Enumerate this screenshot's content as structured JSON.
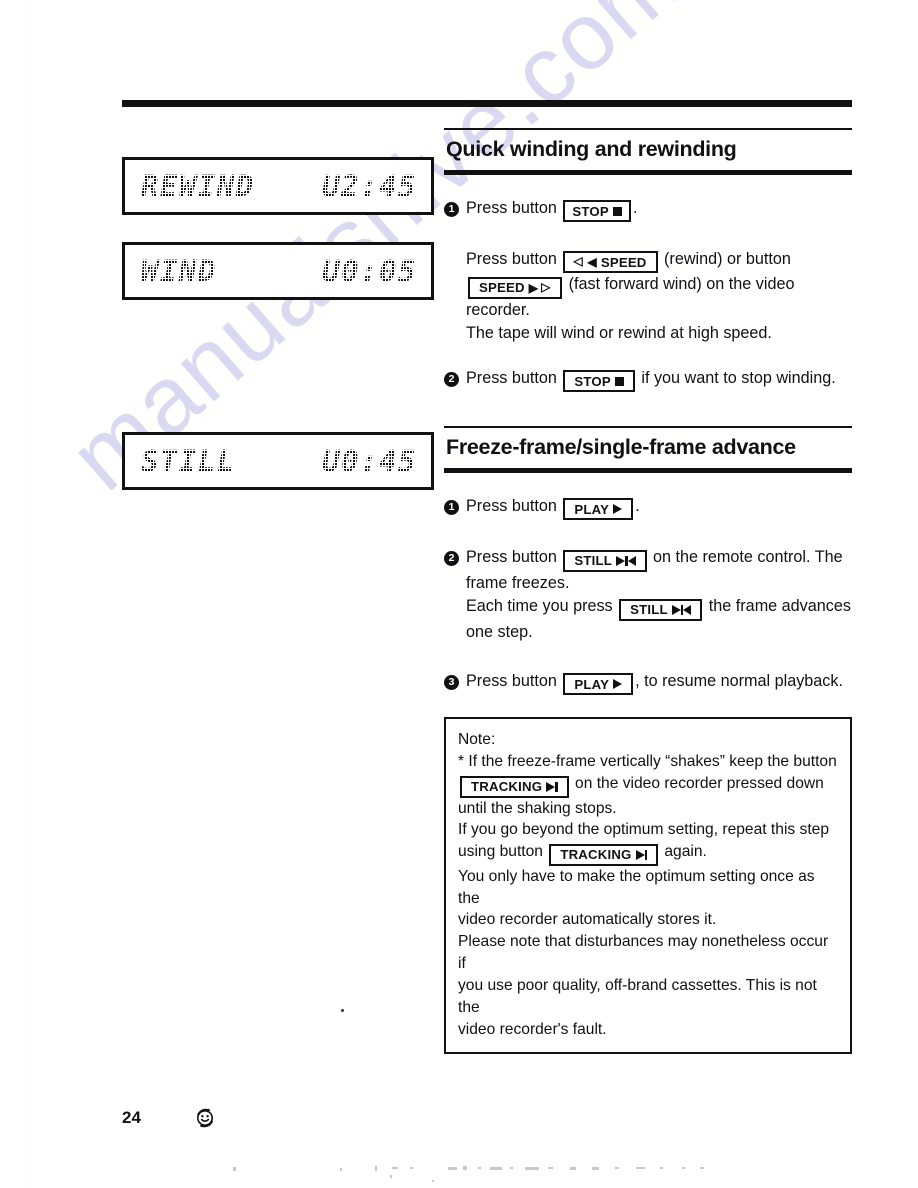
{
  "page": {
    "number": "24",
    "watermark": "manualshive.com",
    "recycle_icon": "smiley-recycle-icon"
  },
  "displays": [
    {
      "name": "rewind-display",
      "label": "REWIND",
      "time": "U2:45"
    },
    {
      "name": "wind-display",
      "label": "WIND",
      "time": "U0:05"
    },
    {
      "name": "still-display",
      "label": "STILL",
      "time": "U0:45"
    }
  ],
  "sections": [
    {
      "id": "quick-winding",
      "title": "Quick winding and rewinding",
      "steps": [
        {
          "num": "1",
          "pre": "Press button",
          "button": "STOP",
          "post": "."
        },
        {
          "num": "2",
          "pre": "Press button",
          "button": "STOP",
          "post": "if you want to stop winding."
        }
      ],
      "paragraph": {
        "line1_pre": "Press button",
        "line1_btn": "SPEED",
        "line1_mid": "(rewind) or button",
        "line2_btn": "SPEED",
        "line2_mid": "(fast forward wind) on the video recorder.",
        "line3": "The tape will wind or rewind at high speed."
      }
    },
    {
      "id": "freeze-frame",
      "title": "Freeze-frame/single-frame advance",
      "steps": [
        {
          "num": "1",
          "pre": "Press button",
          "button": "PLAY",
          "post": "."
        },
        {
          "num": "2",
          "pre": "Press button",
          "button": "STILL",
          "post": "on the remote control. The",
          "line2": "frame freezes.",
          "line3_pre": "Each time you press",
          "line3_btn": "STILL",
          "line3_post": "the frame advances",
          "line4": "one step."
        },
        {
          "num": "3",
          "pre": "Press button",
          "button": "PLAY",
          "post": ", to resume normal playback."
        }
      ]
    }
  ],
  "note": {
    "heading": "Note:",
    "line1": "* If the freeze-frame vertically “shakes” keep the button",
    "line2_btn": "TRACKING",
    "line2_text": "on the video recorder pressed down",
    "line3": "until the shaking stops.",
    "line4": "If you go beyond the optimum setting, repeat this step",
    "line5_pre": "using button",
    "line5_btn": "TRACKING",
    "line5_post": "again.",
    "line6": "You only have to make the optimum setting once as the",
    "line7": "video recorder automatically stores it.",
    "line8": "Please note that disturbances may nonetheless occur if",
    "line9": "you use poor quality, off-brand cassettes. This is not the",
    "line10": "video recorder's fault."
  },
  "colors": {
    "ink": "#111111",
    "paper": "#ffffff",
    "watermark": "#d9d9f2"
  }
}
